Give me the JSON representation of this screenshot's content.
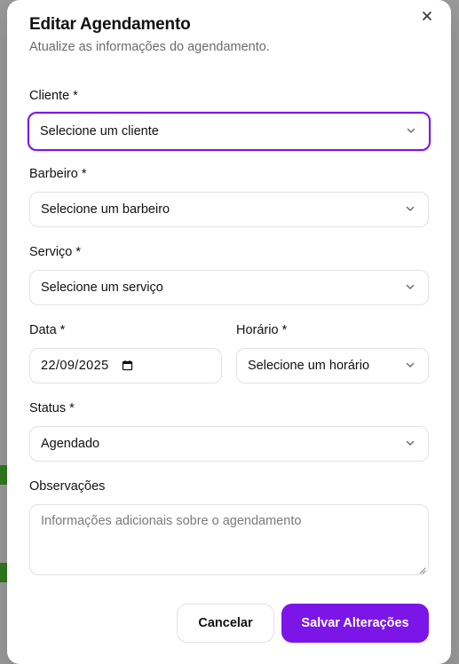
{
  "dialog": {
    "title": "Editar Agendamento",
    "subtitle": "Atualize as informações do agendamento.",
    "close_icon": "close-icon"
  },
  "form": {
    "cliente": {
      "label": "Cliente *",
      "value": "Selecione um cliente"
    },
    "barbeiro": {
      "label": "Barbeiro *",
      "value": "Selecione um barbeiro"
    },
    "servico": {
      "label": "Serviço *",
      "value": "Selecione um serviço"
    },
    "data": {
      "label": "Data *",
      "value": "22/09/2025"
    },
    "horario": {
      "label": "Horário *",
      "value": "Selecione um horário"
    },
    "status": {
      "label": "Status *",
      "value": "Agendado"
    },
    "observacoes": {
      "label": "Observações",
      "placeholder": "Informações adicionais sobre o agendamento"
    }
  },
  "actions": {
    "cancel_label": "Cancelar",
    "save_label": "Salvar Alterações"
  },
  "colors": {
    "accent": "#7c16e8",
    "border": "#e2e2e2",
    "muted_text": "#6b6b6b"
  }
}
